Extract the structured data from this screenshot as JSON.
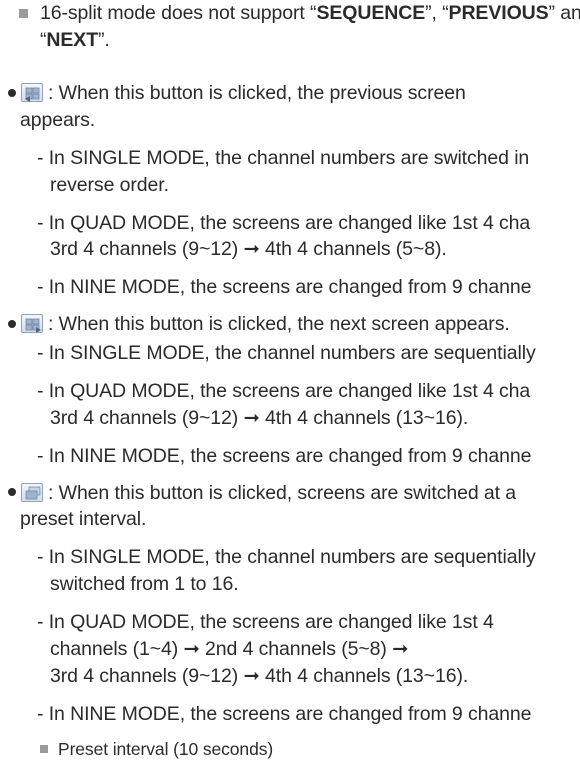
{
  "note_top": {
    "part1": "16-split mode does not support “",
    "sequence": "SEQUENCE",
    "part2": "”, “",
    "previous": "PREVIOUS",
    "part3": "” and",
    "part4": "“",
    "next": "NEXT",
    "part5": "”."
  },
  "previous_section": {
    "icon": "previous-screen-icon",
    "line1": ": When this button is clicked, the previous screen",
    "line2": "appears.",
    "single_1": "- In SINGLE MODE, the channel numbers are switched in",
    "single_2": "reverse order.",
    "quad_1": "- In QUAD MODE, the screens are changed like 1st 4 cha",
    "quad_2": "3rd 4 channels (9~12) ➞ 4th 4 channels (5~8).",
    "nine_1": "- In NINE MODE, the screens are changed from 9 channe"
  },
  "next_section": {
    "icon": "next-screen-icon",
    "line1": ": When this button is clicked, the next screen appears.",
    "single_1": "- In SINGLE MODE, the channel numbers are sequentially",
    "quad_1": "- In QUAD MODE, the screens are changed like 1st 4 cha",
    "quad_2": "3rd 4 channels (9~12) ➞ 4th 4 channels (13~16).",
    "nine_1": "- In NINE MODE, the screens are changed from 9 channe"
  },
  "sequence_section": {
    "icon": "sequence-screen-icon",
    "line1": ": When this button is clicked, screens are switched at a",
    "line2": "preset interval.",
    "single_1": "- In SINGLE MODE, the channel numbers are sequentially",
    "single_2": "switched from 1 to 16.",
    "quad_1": "- In QUAD MODE, the screens are changed like 1st 4",
    "quad_2": "channels (1~4) ➞ 2nd 4 channels (5~8) ➞",
    "quad_3": "3rd 4 channels (9~12) ➞ 4th 4 channels (13~16).",
    "nine_1": "- In NINE MODE, the screens are changed from 9 channe",
    "preset_note": "Preset interval (10 seconds)"
  }
}
